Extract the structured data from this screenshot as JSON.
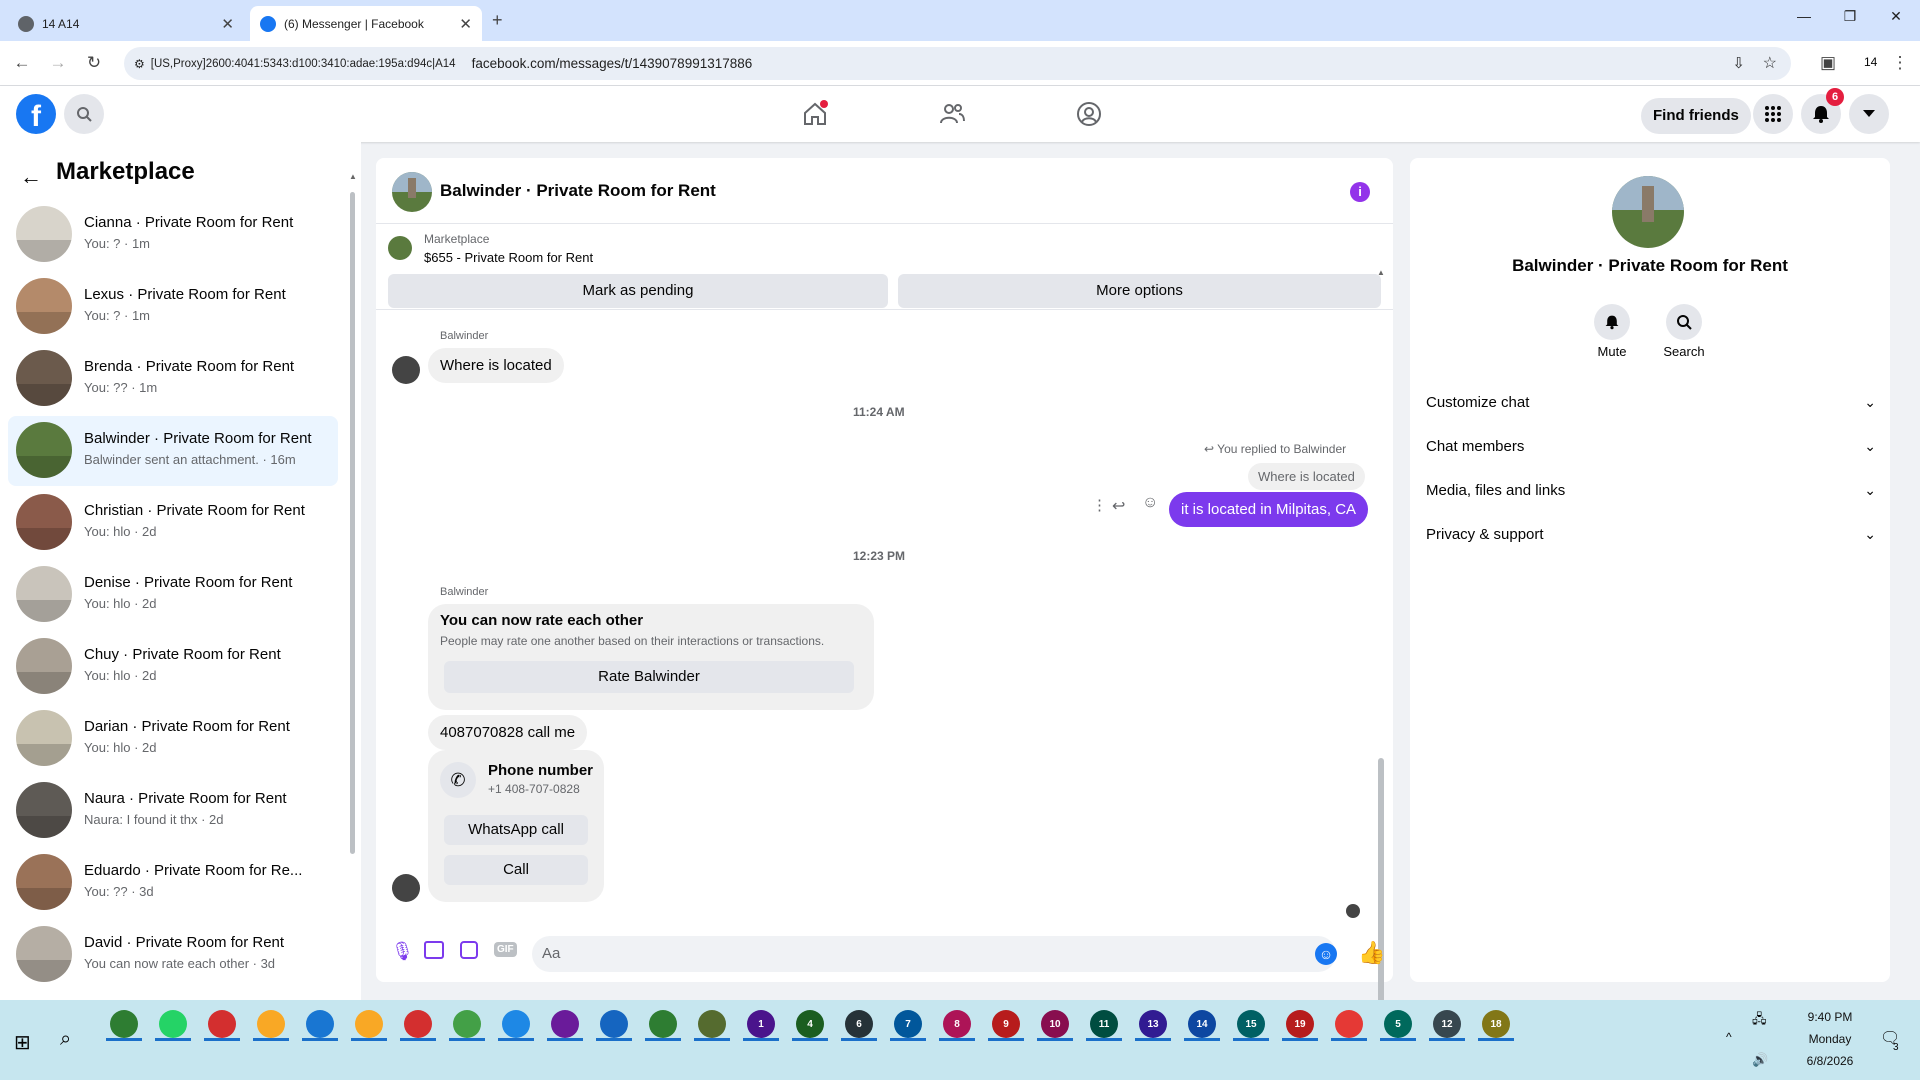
{
  "browser": {
    "tabs": [
      {
        "title": "14 A14",
        "active": false
      },
      {
        "title": "(6) Messenger | Facebook",
        "active": true
      }
    ],
    "new_tab": "+",
    "address_prefix": "[US,Proxy]2600:4041:5343:d100:3410:adae:195a:d94c|A14",
    "url": "facebook.com/messages/t/1439078991317886",
    "profile_count": "14"
  },
  "fb": {
    "find_friends": "Find friends",
    "notif_count": "6"
  },
  "left": {
    "title": "Marketplace",
    "convos": [
      {
        "name": "Cianna · Private Room for Rent",
        "snip": "You: ? · 1m",
        "color": "#d8d4cb"
      },
      {
        "name": "Lexus · Private Room for Rent",
        "snip": "You: ? · 1m",
        "color": "#b48a6a"
      },
      {
        "name": "Brenda · Private Room for Rent",
        "snip": "You: ?? · 1m",
        "color": "#6b5a4c"
      },
      {
        "name": "Balwinder · Private Room for Rent",
        "snip": "Balwinder sent an attachment. · 16m",
        "color": "#5a7a3e"
      },
      {
        "name": "Christian · Private Room for Rent",
        "snip": "You: hlo · 2d",
        "color": "#8a5a4a"
      },
      {
        "name": "Denise · Private Room for Rent",
        "snip": "You: hlo · 2d",
        "color": "#c9c4bb"
      },
      {
        "name": "Chuy · Private Room for Rent",
        "snip": "You: hlo · 2d",
        "color": "#a9a094"
      },
      {
        "name": "Darian · Private Room for Rent",
        "snip": "You: hlo · 2d",
        "color": "#c8c2b0"
      },
      {
        "name": "Naura · Private Room for Rent",
        "snip": "Naura: I found it thx · 2d",
        "color": "#5e5a55"
      },
      {
        "name": "Eduardo · Private Room for Re...",
        "snip": "You: ?? · 3d",
        "color": "#9a7258"
      },
      {
        "name": "David · Private Room for Rent",
        "snip": "You can now rate each other · 3d",
        "color": "#b5aea4"
      }
    ]
  },
  "chat": {
    "title": "Balwinder · Private Room for Rent",
    "marketplace_label": "Marketplace",
    "listing": "$655 - Private Room for Rent",
    "mark_pending": "Mark as pending",
    "more_options": "More options",
    "sender1": "Balwinder",
    "msg1": "Where is located",
    "time1": "11:24 AM",
    "replied": "You replied to Balwinder",
    "quoted": "Where is located",
    "my_msg": "it is located in Milpitas, CA",
    "time2": "12:23 PM",
    "sender2": "Balwinder",
    "rate_title": "You can now rate each other",
    "rate_sub": "People may rate one another based on their interactions or transactions.",
    "rate_btn": "Rate Balwinder",
    "msg2": "4087070828 call me",
    "phone_title": "Phone number",
    "phone_num": "+1 408-707-0828",
    "whatsapp": "WhatsApp call",
    "call": "Call",
    "input_placeholder": "Aa",
    "accent": "#7c3aed"
  },
  "right": {
    "name": "Balwinder · Private Room for Rent",
    "mute": "Mute",
    "search": "Search",
    "options": [
      "Customize chat",
      "Chat members",
      "Media, files and links",
      "Privacy & support"
    ]
  },
  "taskbar": {
    "time": "9:40 PM",
    "day": "Monday",
    "date": "6/8/2026",
    "notif": "3",
    "apps": [
      "",
      "",
      "",
      "",
      "",
      "",
      "",
      "",
      "",
      "",
      "",
      "",
      "",
      "1",
      "4",
      "6",
      "7",
      "8",
      "9",
      "10",
      "11",
      "13",
      "14",
      "15",
      "19",
      "",
      "5",
      "12",
      "18"
    ]
  }
}
